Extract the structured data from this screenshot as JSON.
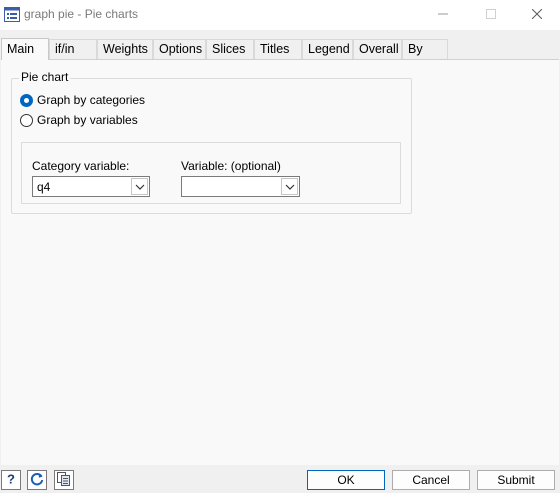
{
  "window": {
    "title": "graph pie - Pie charts",
    "icon": "dialog-icon",
    "controls": [
      "minimize-icon",
      "maximize-icon",
      "close-icon"
    ]
  },
  "tabs": [
    {
      "label": "Main",
      "active": true
    },
    {
      "label": "if/in"
    },
    {
      "label": "Weights"
    },
    {
      "label": "Options"
    },
    {
      "label": "Slices"
    },
    {
      "label": "Titles"
    },
    {
      "label": "Legend"
    },
    {
      "label": "Overall"
    },
    {
      "label": "By"
    }
  ],
  "main": {
    "group_title": "Pie chart",
    "radio_options": [
      {
        "label": "Graph by categories",
        "checked": true
      },
      {
        "label": "Graph by variables",
        "checked": false
      }
    ],
    "category_variable": {
      "label": "Category variable:",
      "value": "q4"
    },
    "variable_optional": {
      "label": "Variable: (optional)",
      "value": ""
    }
  },
  "footer": {
    "help_icon": "help-icon",
    "reset_icon": "reset-icon",
    "copy_icon": "copy-command-icon",
    "ok_label": "OK",
    "cancel_label": "Cancel",
    "submit_label": "Submit"
  },
  "colors": {
    "accent": "#0067c0",
    "title_text": "#7a7a7a",
    "panel_bg": "#f9f9f9",
    "chrome_bg": "#f0f0f0"
  }
}
